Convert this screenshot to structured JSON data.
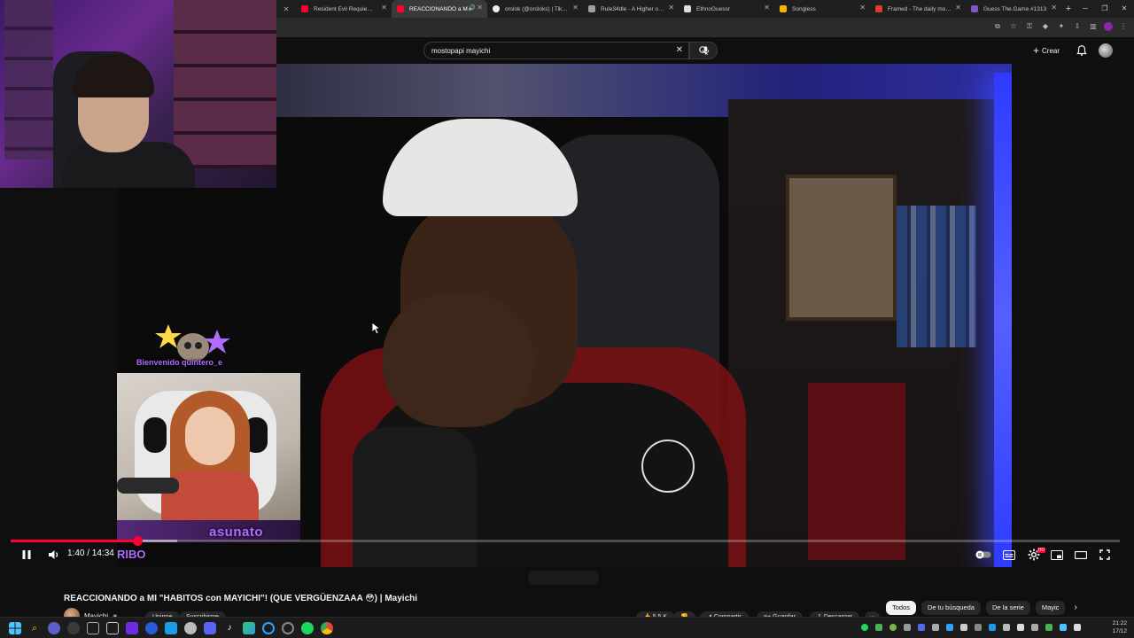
{
  "browser": {
    "tabs": [
      {
        "label": "Resident Evil Requiem - T",
        "active": false,
        "favicon_color": "#ff0033"
      },
      {
        "label": "REACCIONANDO a M",
        "active": true,
        "favicon_color": "#ff0033"
      },
      {
        "label": "orslok (@orsloks) | TikTok",
        "active": false,
        "favicon_color": "#eeeeee"
      },
      {
        "label": "Rule34dle - A Higher or L",
        "active": false,
        "favicon_color": "#9aa0a6"
      },
      {
        "label": "EthnoGuessr",
        "active": false,
        "favicon_color": "#dddddd"
      },
      {
        "label": "Songless",
        "active": false,
        "favicon_color": "#f5b400"
      },
      {
        "label": "Framed - The daily movie",
        "active": false,
        "favicon_color": "#e53935"
      },
      {
        "label": "Guess The.Game #1313",
        "active": false,
        "favicon_color": "#7e57c2"
      }
    ]
  },
  "youtube": {
    "search_value": "mostopapi mayichi",
    "create_label": "Crear"
  },
  "video": {
    "current_time": "1:40",
    "duration": "14:34",
    "time_display": "1:40 / 14:34",
    "progress_fraction": 0.114,
    "buffered_fraction": 0.15
  },
  "overlay": {
    "alert_text": "Bienvenido quintero_e",
    "streamer_name": "asunato",
    "streamer_tag": "RIBO",
    "accent_color": "#b06cff"
  },
  "below": {
    "title": "REACCIONANDO a MI \"HABITOS con MAYICHI\"! (QUE VERGÜENZAAA 😳) | Mayichi",
    "channel": "Mayichi",
    "join_label": "Unirme",
    "subscribe_label": "Suscribirme",
    "likes": "5,5 K",
    "share_label": "Compartir",
    "save_label": "Guardar",
    "download_label": "Descargar",
    "filters": [
      {
        "label": "Todos",
        "selected": true
      },
      {
        "label": "De tu búsqueda",
        "selected": false
      },
      {
        "label": "De la serie",
        "selected": false
      },
      {
        "label": "Mayic",
        "selected": false
      }
    ]
  },
  "taskbar": {
    "time": "21:22",
    "date": "17/12"
  }
}
